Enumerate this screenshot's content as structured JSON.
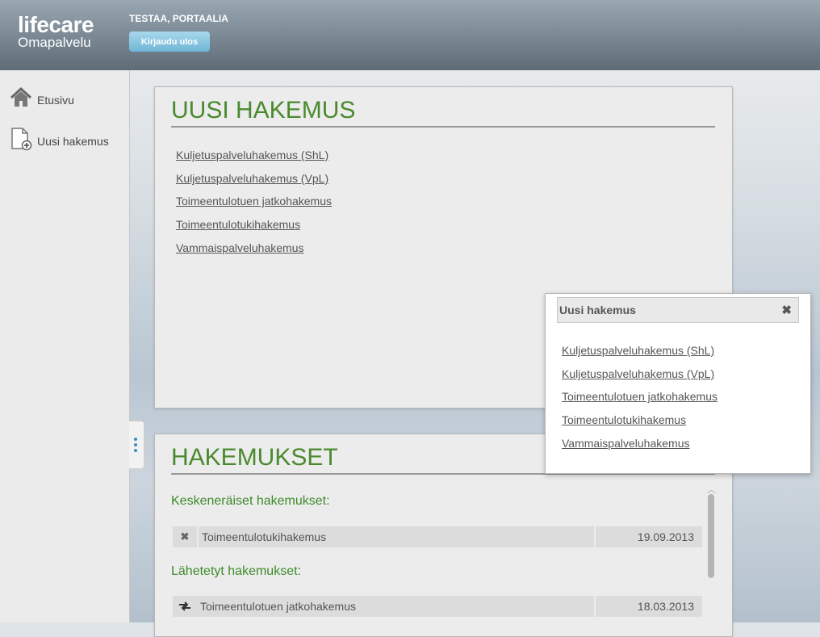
{
  "header": {
    "logo_main": "lifecare",
    "logo_sub": "Omapalvelu",
    "user_name": "TESTAA, PORTAALIA",
    "logout_label": "Kirjaudu ulos"
  },
  "sidebar": {
    "items": [
      {
        "label": "Etusivu",
        "icon": "home-icon"
      },
      {
        "label": "Uusi hakemus",
        "icon": "new-document-icon"
      }
    ]
  },
  "new_application": {
    "title": "UUSI HAKEMUS",
    "links": [
      "Kuljetuspalveluhakemus (ShL)",
      "Kuljetuspalveluhakemus (VpL)",
      "Toimeentulotuen jatkohakemus",
      "Toimeentulotukihakemus",
      "Vammaispalveluhakemus"
    ]
  },
  "applications": {
    "title": "HAKEMUKSET",
    "incomplete_heading": "Keskeneräiset hakemukset:",
    "incomplete": [
      {
        "name": "Toimeentulotukihakemus",
        "date": "19.09.2013",
        "icon": "delete-icon"
      }
    ],
    "sent_heading": "Lähetetyt hakemukset:",
    "sent": [
      {
        "name": "Toimeentulotuen jatkohakemus",
        "date": "18.03.2013",
        "icon": "transfer-icon"
      }
    ]
  },
  "popup": {
    "title": "Uusi hakemus",
    "close_icon": "close-icon",
    "links": [
      "Kuljetuspalveluhakemus (ShL)",
      "Kuljetuspalveluhakemus (VpL)",
      "Toimeentulotuen jatkohakemus",
      "Toimeentulotukihakemus",
      "Vammaispalveluhakemus"
    ]
  },
  "colors": {
    "accent_green": "#4a8a2e",
    "logout_blue": "#6fb6d6"
  }
}
